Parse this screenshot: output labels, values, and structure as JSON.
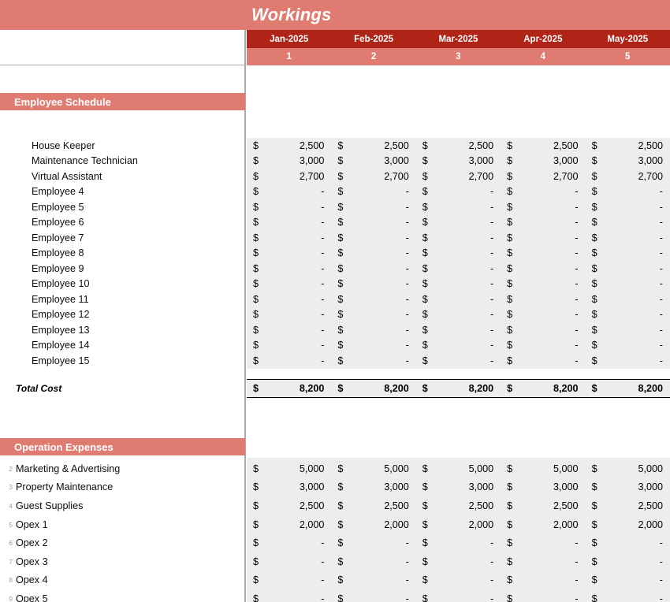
{
  "title": "Workings",
  "columns": {
    "months": [
      "Jan-2025",
      "Feb-2025",
      "Mar-2025",
      "Apr-2025",
      "May-2025"
    ],
    "periods": [
      "1",
      "2",
      "3",
      "4",
      "5"
    ]
  },
  "currency_symbol": "$",
  "zero_placeholder": "-",
  "colors": {
    "title_band": "#E07B72",
    "month_band": "#B02418",
    "period_band": "#E07B72",
    "section_band": "#E07B72",
    "data_fill": "#EDEDED",
    "gridline": "#AAAAAA",
    "header_text": "#FFFFFF"
  },
  "sections": [
    {
      "name": "Employee Schedule",
      "rows": [
        {
          "num": "",
          "label": "House Keeper",
          "values": [
            "2,500",
            "2,500",
            "2,500",
            "2,500",
            "2,500"
          ]
        },
        {
          "num": "",
          "label": "Maintenance Technician",
          "values": [
            "3,000",
            "3,000",
            "3,000",
            "3,000",
            "3,000"
          ]
        },
        {
          "num": "",
          "label": "Virtual Assistant",
          "values": [
            "2,700",
            "2,700",
            "2,700",
            "2,700",
            "2,700"
          ]
        },
        {
          "num": "",
          "label": "Employee 4",
          "values": [
            "-",
            "-",
            "-",
            "-",
            "-"
          ]
        },
        {
          "num": "",
          "label": "Employee 5",
          "values": [
            "-",
            "-",
            "-",
            "-",
            "-"
          ]
        },
        {
          "num": "",
          "label": "Employee 6",
          "values": [
            "-",
            "-",
            "-",
            "-",
            "-"
          ]
        },
        {
          "num": "",
          "label": "Employee 7",
          "values": [
            "-",
            "-",
            "-",
            "-",
            "-"
          ]
        },
        {
          "num": "",
          "label": "Employee 8",
          "values": [
            "-",
            "-",
            "-",
            "-",
            "-"
          ]
        },
        {
          "num": "",
          "label": "Employee 9",
          "values": [
            "-",
            "-",
            "-",
            "-",
            "-"
          ]
        },
        {
          "num": "",
          "label": "Employee 10",
          "values": [
            "-",
            "-",
            "-",
            "-",
            "-"
          ]
        },
        {
          "num": "",
          "label": "Employee 11",
          "values": [
            "-",
            "-",
            "-",
            "-",
            "-"
          ]
        },
        {
          "num": "",
          "label": "Employee 12",
          "values": [
            "-",
            "-",
            "-",
            "-",
            "-"
          ]
        },
        {
          "num": "",
          "label": "Employee 13",
          "values": [
            "-",
            "-",
            "-",
            "-",
            "-"
          ]
        },
        {
          "num": "",
          "label": "Employee 14",
          "values": [
            "-",
            "-",
            "-",
            "-",
            "-"
          ]
        },
        {
          "num": "",
          "label": "Employee 15",
          "values": [
            "-",
            "-",
            "-",
            "-",
            "-"
          ]
        }
      ],
      "total": {
        "label": "Total Cost",
        "values": [
          "8,200",
          "8,200",
          "8,200",
          "8,200",
          "8,200"
        ]
      }
    },
    {
      "name": "Operation Expenses",
      "rows": [
        {
          "num": "2",
          "label": "Marketing & Advertising",
          "values": [
            "5,000",
            "5,000",
            "5,000",
            "5,000",
            "5,000"
          ]
        },
        {
          "num": "3",
          "label": "Property Maintenance",
          "values": [
            "3,000",
            "3,000",
            "3,000",
            "3,000",
            "3,000"
          ]
        },
        {
          "num": "4",
          "label": "Guest Supplies",
          "values": [
            "2,500",
            "2,500",
            "2,500",
            "2,500",
            "2,500"
          ]
        },
        {
          "num": "5",
          "label": "Opex 1",
          "values": [
            "2,000",
            "2,000",
            "2,000",
            "2,000",
            "2,000"
          ]
        },
        {
          "num": "6",
          "label": "Opex 2",
          "values": [
            "-",
            "-",
            "-",
            "-",
            "-"
          ]
        },
        {
          "num": "7",
          "label": "Opex 3",
          "values": [
            "-",
            "-",
            "-",
            "-",
            "-"
          ]
        },
        {
          "num": "8",
          "label": "Opex 4",
          "values": [
            "-",
            "-",
            "-",
            "-",
            "-"
          ]
        },
        {
          "num": "9",
          "label": "Opex 5",
          "values": [
            "-",
            "-",
            "-",
            "-",
            "-"
          ]
        }
      ],
      "total": null
    }
  ]
}
